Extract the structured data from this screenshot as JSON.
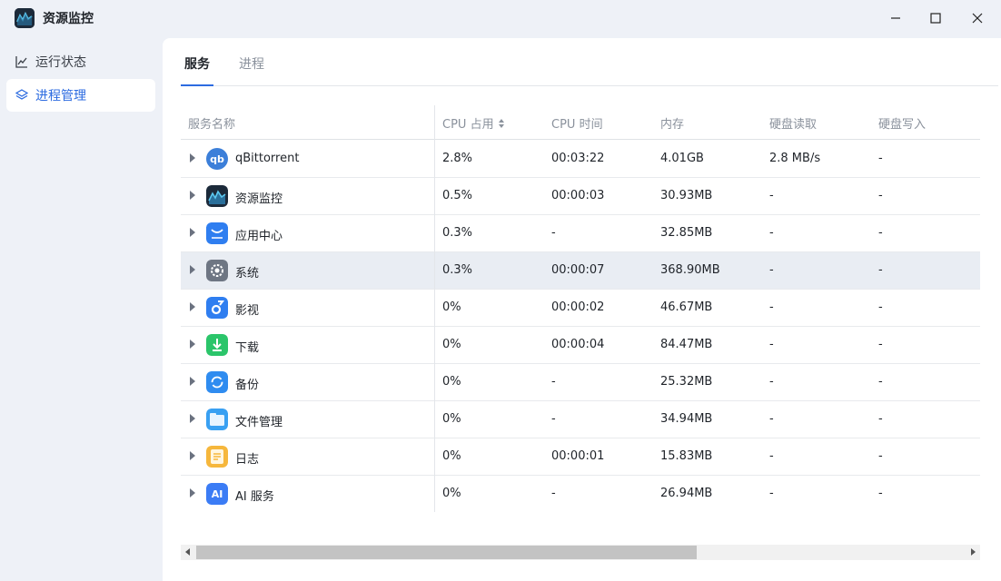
{
  "window": {
    "title": "资源监控",
    "controls": [
      "minimize-icon",
      "maximize-icon",
      "close-icon"
    ]
  },
  "sidebar": {
    "items": [
      {
        "label": "运行状态",
        "icon": "line-chart-icon",
        "active": false
      },
      {
        "label": "进程管理",
        "icon": "layers-icon",
        "active": true
      }
    ]
  },
  "tabs": [
    {
      "label": "服务",
      "active": true
    },
    {
      "label": "进程",
      "active": false
    }
  ],
  "table": {
    "headers": [
      "服务名称",
      "CPU 占用",
      "CPU 时间",
      "内存",
      "硬盘读取",
      "硬盘写入"
    ],
    "sort_column": "CPU 占用",
    "rows": [
      {
        "name": "qBittorrent",
        "icon": "qbittorrent-icon",
        "cpu": "2.8%",
        "cpu_time": "00:03:22",
        "memory": "4.01GB",
        "disk_read": "2.8 MB/s",
        "disk_write": "-"
      },
      {
        "name": "资源监控",
        "icon": "resource-monitor-icon",
        "cpu": "0.5%",
        "cpu_time": "00:00:03",
        "memory": "30.93MB",
        "disk_read": "-",
        "disk_write": "-"
      },
      {
        "name": "应用中心",
        "icon": "app-store-icon",
        "cpu": "0.3%",
        "cpu_time": "-",
        "memory": "32.85MB",
        "disk_read": "-",
        "disk_write": "-"
      },
      {
        "name": "系统",
        "icon": "gear-icon",
        "cpu": "0.3%",
        "cpu_time": "00:00:07",
        "memory": "368.90MB",
        "disk_read": "-",
        "disk_write": "-"
      },
      {
        "name": "影视",
        "icon": "video-icon",
        "cpu": "0%",
        "cpu_time": "00:00:02",
        "memory": "46.67MB",
        "disk_read": "-",
        "disk_write": "-"
      },
      {
        "name": "下载",
        "icon": "download-icon",
        "cpu": "0%",
        "cpu_time": "00:00:04",
        "memory": "84.47MB",
        "disk_read": "-",
        "disk_write": "-"
      },
      {
        "name": "备份",
        "icon": "backup-icon",
        "cpu": "0%",
        "cpu_time": "-",
        "memory": "25.32MB",
        "disk_read": "-",
        "disk_write": "-"
      },
      {
        "name": "文件管理",
        "icon": "folder-icon",
        "cpu": "0%",
        "cpu_time": "-",
        "memory": "34.94MB",
        "disk_read": "-",
        "disk_write": "-"
      },
      {
        "name": "日志",
        "icon": "log-icon",
        "cpu": "0%",
        "cpu_time": "00:00:01",
        "memory": "15.83MB",
        "disk_read": "-",
        "disk_write": "-"
      },
      {
        "name": "AI 服务",
        "icon": "ai-icon",
        "cpu": "0%",
        "cpu_time": "-",
        "memory": "26.94MB",
        "disk_read": "-",
        "disk_write": "-"
      }
    ]
  },
  "colors": {
    "accent": "#2c6be0",
    "background": "#eef1f7",
    "highlight_row": "#e9edf3"
  }
}
